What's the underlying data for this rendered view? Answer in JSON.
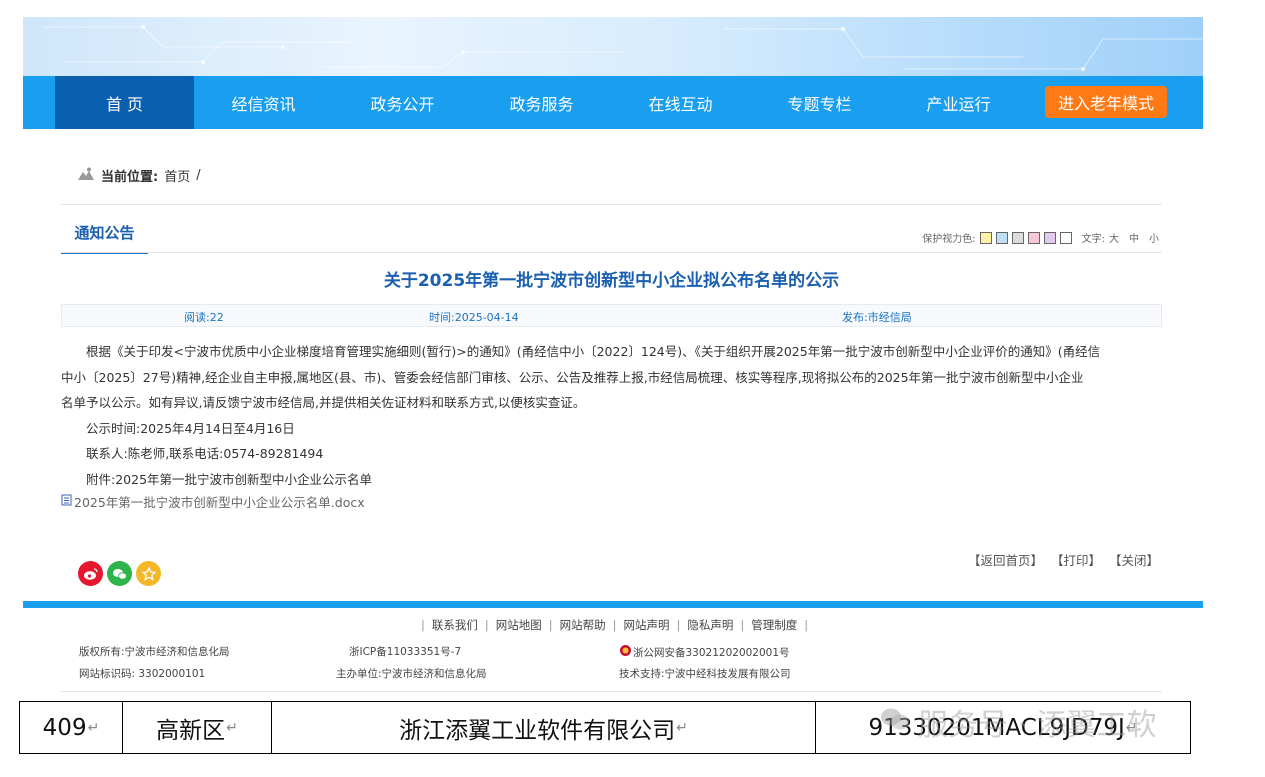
{
  "nav": {
    "items": [
      "首 页",
      "经信资讯",
      "政务公开",
      "政务服务",
      "在线互动",
      "专题专栏",
      "产业运行"
    ],
    "elder_mode": "进入老年模式"
  },
  "breadcrumb": {
    "label": "当前位置:",
    "home": "首页",
    "sep": "/"
  },
  "section": {
    "tab": "通知公告"
  },
  "tools": {
    "eye_label": "保护视力色:",
    "swatches": [
      "#fff3a6",
      "#bde0f7",
      "#dcdcdc",
      "#f7c6d9",
      "#e2c9f0",
      "#ffffff"
    ],
    "text_label": "文字:",
    "big": "大",
    "mid": "中",
    "small": "小"
  },
  "article": {
    "title": "关于2025年第一批宁波市创新型中小企业拟公布名单的公示",
    "reads": "阅读:22",
    "time": "时间:2025-04-14",
    "publisher": "发布:市经信局",
    "para1_line1": "根据《关于印发<宁波市优质中小企业梯度培育管理实施细则(暂行)>的通知》(甬经信中小〔2022〕124号)、《关于组织开展2025年第一批宁波市创新型中小企业评价的通知》(甬经信",
    "para1_line2": "中小〔2025〕27号)精神,经企业自主申报,属地区(县、市)、管委会经信部门审核、公示、公告及推荐上报,市经信局梳理、核实等程序,现将拟公布的2025年第一批宁波市创新型中小企业",
    "para1_line3": "名单予以公示。如有异议,请反馈宁波市经信局,并提供相关佐证材料和联系方式,以便核实查证。",
    "period": "公示时间:2025年4月14日至4月16日",
    "contact": "联系人:陈老师,联系电话:0574-89281494",
    "attachment_label": "附件:2025年第一批宁波市创新型中小企业公示名单",
    "attachment_file": "2025年第一批宁波市创新型中小企业公示名单.docx"
  },
  "actions": {
    "home": "【返回首页】",
    "print": "【打印】",
    "close": "【关闭】"
  },
  "footer": {
    "links": [
      "联系我们",
      "网站地图",
      "网站帮助",
      "网站声明",
      "隐私声明",
      "管理制度"
    ],
    "copyright": "版权所有:宁波市经济和信息化局",
    "site_id": "网站标识码: 3302000101",
    "icp": "浙ICP备11033351号-7",
    "sponsor": "主办单位:宁波市经济和信息化局",
    "police": "浙公网安备33021202002001号",
    "tech": "技术支持:宁波中经科技发展有限公司"
  },
  "table_row": {
    "no": "409",
    "district": "高新区",
    "company": "浙江添翼工业软件有限公司",
    "code": "91330201MACL9JD79J"
  },
  "watermark": "服务号 · 添翼工软"
}
